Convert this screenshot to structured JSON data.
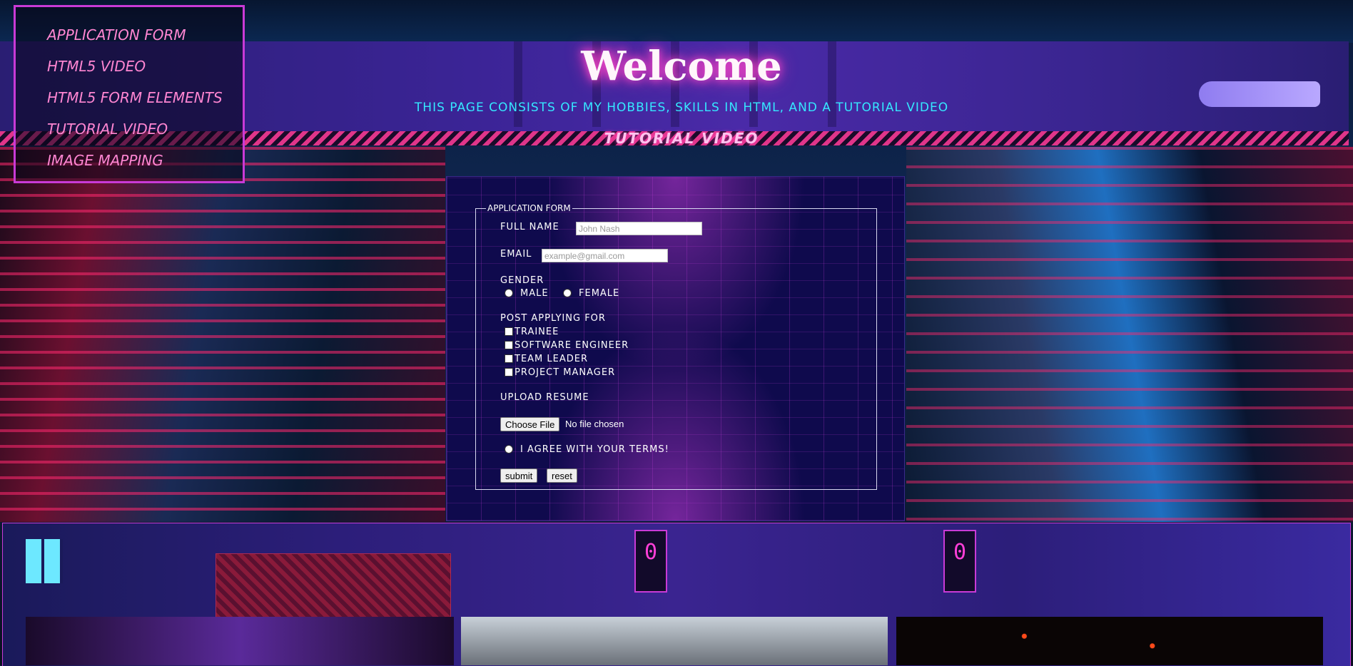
{
  "nav": {
    "items": [
      {
        "label": "Application form"
      },
      {
        "label": "HTML5 Video"
      },
      {
        "label": "HTML5 Form Elements"
      },
      {
        "label": "Tutorial Video"
      },
      {
        "label": "Image mapping"
      }
    ]
  },
  "header": {
    "title": "Welcome",
    "subtitle": "This page consists of my hobbies, skills in HTML, and a tutorial video",
    "section_title": "Tutorial Video"
  },
  "form": {
    "legend": "Application Form",
    "full_name_label": "Full Name",
    "full_name_placeholder": "John Nash",
    "email_label": "Email",
    "email_placeholder": "example@gmail.com",
    "gender_label": "Gender",
    "gender_options": [
      "Male",
      "Female"
    ],
    "post_label": "Post applying for",
    "post_options": [
      "Trainee",
      "Software Engineer",
      "Team Leader",
      "Project Manager"
    ],
    "resume_label": "Upload Resume",
    "choose_file_label": "Choose File",
    "file_status": "No file chosen",
    "agree_label": "I agree with your terms!",
    "submit_label": "submit",
    "reset_label": "reset"
  },
  "decor": {
    "slot_glyph": "0"
  },
  "colors": {
    "accent_pink": "#ff86d2",
    "accent_cyan": "#35e8ff",
    "border_magenta": "#c93ad6"
  }
}
